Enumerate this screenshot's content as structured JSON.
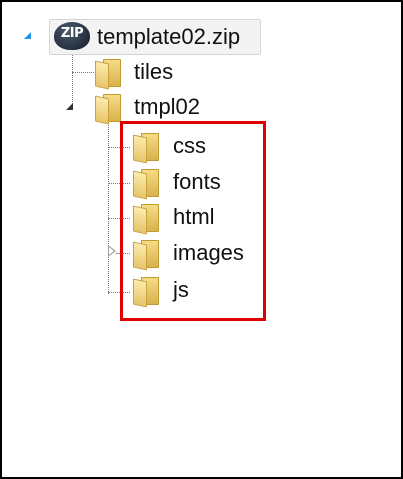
{
  "tree": {
    "root": {
      "label": "template02.zip",
      "icon": "zip-archive-icon",
      "expanded": true,
      "selected": true
    },
    "children": [
      {
        "label": "tiles",
        "icon": "folder-icon",
        "has_children": false
      },
      {
        "label": "tmpl02",
        "icon": "folder-icon",
        "expanded": true,
        "children": [
          {
            "label": "css",
            "icon": "folder-icon"
          },
          {
            "label": "fonts",
            "icon": "folder-icon"
          },
          {
            "label": "html",
            "icon": "folder-icon"
          },
          {
            "label": "images",
            "icon": "folder-icon",
            "expandable": true,
            "expanded": false
          },
          {
            "label": "js",
            "icon": "folder-icon"
          }
        ]
      }
    ]
  },
  "highlight": {
    "color": "#e00000"
  },
  "colors": {
    "frame": "#000000",
    "selection_bg": "#f3f3f3",
    "expander_accent": "#1f93e6"
  }
}
